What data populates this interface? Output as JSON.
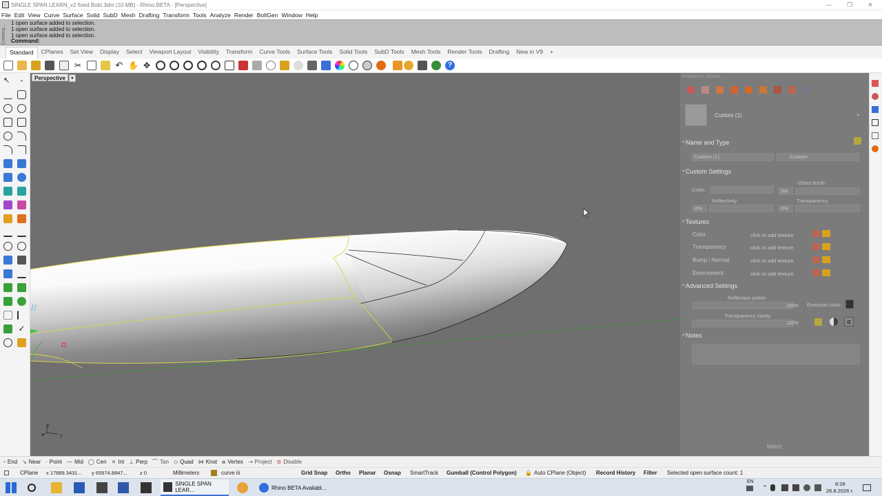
{
  "window": {
    "title": "SINGLE SPAN LEARN_v2 fixed Bobi.3dm (10 MB) - Rhino.BETA - [Perspective]",
    "minimize": "—",
    "restore": "❐",
    "close": "✕"
  },
  "menu": [
    "File",
    "Edit",
    "View",
    "Curve",
    "Surface",
    "Solid",
    "SubD",
    "Mesh",
    "Drafting",
    "Transform",
    "Tools",
    "Analyze",
    "Render",
    "BoltGen",
    "Window",
    "Help"
  ],
  "command": {
    "sidebar_label": "Comma...",
    "history": [
      "1 open surface added to selection.",
      "1 open surface added to selection.",
      "1 open surface added to selection."
    ],
    "prompt": "Command:"
  },
  "tabs": [
    "Standard",
    "CPlanes",
    "Set View",
    "Display",
    "Select",
    "Viewport Layout",
    "Visibility",
    "Transform",
    "Curve Tools",
    "Surface Tools",
    "Solid Tools",
    "SubD Tools",
    "Mesh Tools",
    "Render Tools",
    "Drafting",
    "New in V9",
    "+"
  ],
  "active_tab": "Standard",
  "viewport": {
    "label": "Perspective",
    "caret": "▾",
    "axis_z": "z",
    "axis_x": "x",
    "axis_y": "y"
  },
  "panel": {
    "header": "Properties: Materi...",
    "material_name": "Custom (1)",
    "name_and_type": "Name and Type",
    "name_field": "Custom (1)",
    "type_field": "Custom",
    "custom_settings": "Custom Settings",
    "color_label": "Color:",
    "gloss_finish": "Gloss finish",
    "gloss_value": "0%",
    "reflectivity": "Reflectivity",
    "reflectivity_value": "0%",
    "transparency": "Transparency",
    "transparency_value": "0%",
    "textures": "Textures",
    "texture_rows": [
      "Color",
      "Transparency",
      "Bump / Normal",
      "Environment"
    ],
    "click_add": "click to add texture",
    "advanced_settings": "Advanced Settings",
    "reflection_polish": "Reflection polish",
    "reflection_polish_value": "100%",
    "emission_color": "Emission color:",
    "transparency_clarity": "Transparency clarity",
    "transparency_clarity_value": "100%",
    "notes": "Notes",
    "match": "Match"
  },
  "osnaps": [
    "End",
    "Near",
    "Point",
    "Mid",
    "Cen",
    "Int",
    "Perp",
    "Tan",
    "Quad",
    "Knot",
    "Vertex",
    "Project",
    "Disable"
  ],
  "status": {
    "cplane": "CPlane",
    "coord_x": "x 17889.3431...",
    "coord_y": "y 65974.8847...",
    "coord_z": "z 0",
    "units": "Millimeters",
    "layer": "curve iii",
    "grid_snap": "Grid Snap",
    "ortho": "Ortho",
    "planar": "Planar",
    "osnap": "Osnap",
    "smarttrack": "SmartTrack",
    "gumball": "Gumball (Control Polygon)",
    "auto_cplane": "Auto CPlane (Object)",
    "record_history": "Record History",
    "filter": "Filter",
    "message": "Selected open surface count: 1"
  },
  "taskbar": {
    "task1": "SINGLE SPAN LEAR...",
    "task2": "Rhino BETA Availabl...",
    "lang": "EN",
    "time": "8:28",
    "date": "26.8.2026 г."
  }
}
